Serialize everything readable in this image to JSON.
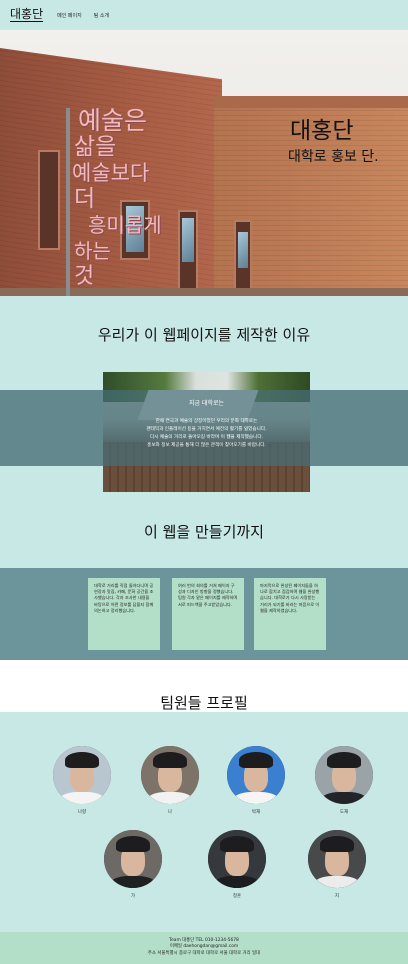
{
  "nav": {
    "brand": "대홍단",
    "links": [
      "메인 페이지",
      "팀 소개"
    ]
  },
  "hero": {
    "sculpture_lines": [
      "예술은",
      "삶을",
      "예술보다",
      "더",
      "흥미롭게",
      "하는",
      "것"
    ],
    "title": "대홍단",
    "subtitle": "대학로 홍보 단."
  },
  "reason": {
    "title": "우리가 이 웹페이지를 제작한 이유",
    "heading": "지금 대학로는",
    "lines": [
      "한때 연극과 예술의 상징이었던 우리의 문화 대학로는",
      "팬데믹과 인플레이션 등을 거치면서 예전의 활기를 잃었습니다.",
      "다시 예술의 거리로 돌아오길 바라며 이 웹을 제작했습니다.",
      "홍보와 정보 제공을 통해 더 많은 관객이 찾아오기를 바랍니다."
    ]
  },
  "process": {
    "title": "이 웹을 만들기까지",
    "cards": [
      "대학로 거리를 직접 돌아다니며 공연장과 맛집, 카페, 문화 공간을 조사했습니다. 각자 조사한 내용을 바탕으로 어떤 정보를 담을지 함께 의논하고 정리했습니다.",
      "여러 번의 회의를 거쳐 페이지 구성과 디자인 방향을 정했습니다. 팀원 각자 맡은 페이지를 제작하며 서로 피드백을 주고받았습니다.",
      "마지막으로 완성된 페이지들을 하나로 합치고 점검하며 웹을 완성했습니다. 대학로가 다시 사랑받는 거리가 되기를 바라는 마음으로 이 웹을 제작하였습니다."
    ]
  },
  "team": {
    "title": "팀원들 프로필",
    "members": [
      {
        "name": "나향",
        "bg": "#b8c6cf",
        "shirt": "#f4f4f4"
      },
      {
        "name": "나",
        "bg": "#7d7368",
        "shirt": "#f2f2f2"
      },
      {
        "name": "박재",
        "bg": "#3b7fd1",
        "shirt": "#f5f5f5"
      },
      {
        "name": "도재",
        "bg": "#9aa3a8",
        "shirt": "#222428"
      },
      {
        "name": "가",
        "bg": "#6d6a66",
        "shirt": "#1f2022"
      },
      {
        "name": "정훈",
        "bg": "#35383c",
        "shirt": "#1c1d20"
      },
      {
        "name": "지",
        "bg": "#47494b",
        "shirt": "#ececec"
      }
    ]
  },
  "footer": {
    "line1": "Team 대홍단  TEL  010-1234-5678",
    "line2": "이메일 daehongdan@gmail.com",
    "line3": "주소 서울특별시 종로구 대학로 대학로 서울 대학로 거리 일대"
  },
  "colors": {
    "background": "#c8e8e6",
    "band_dark": "#6c959b",
    "card": "#b3dfc8"
  }
}
